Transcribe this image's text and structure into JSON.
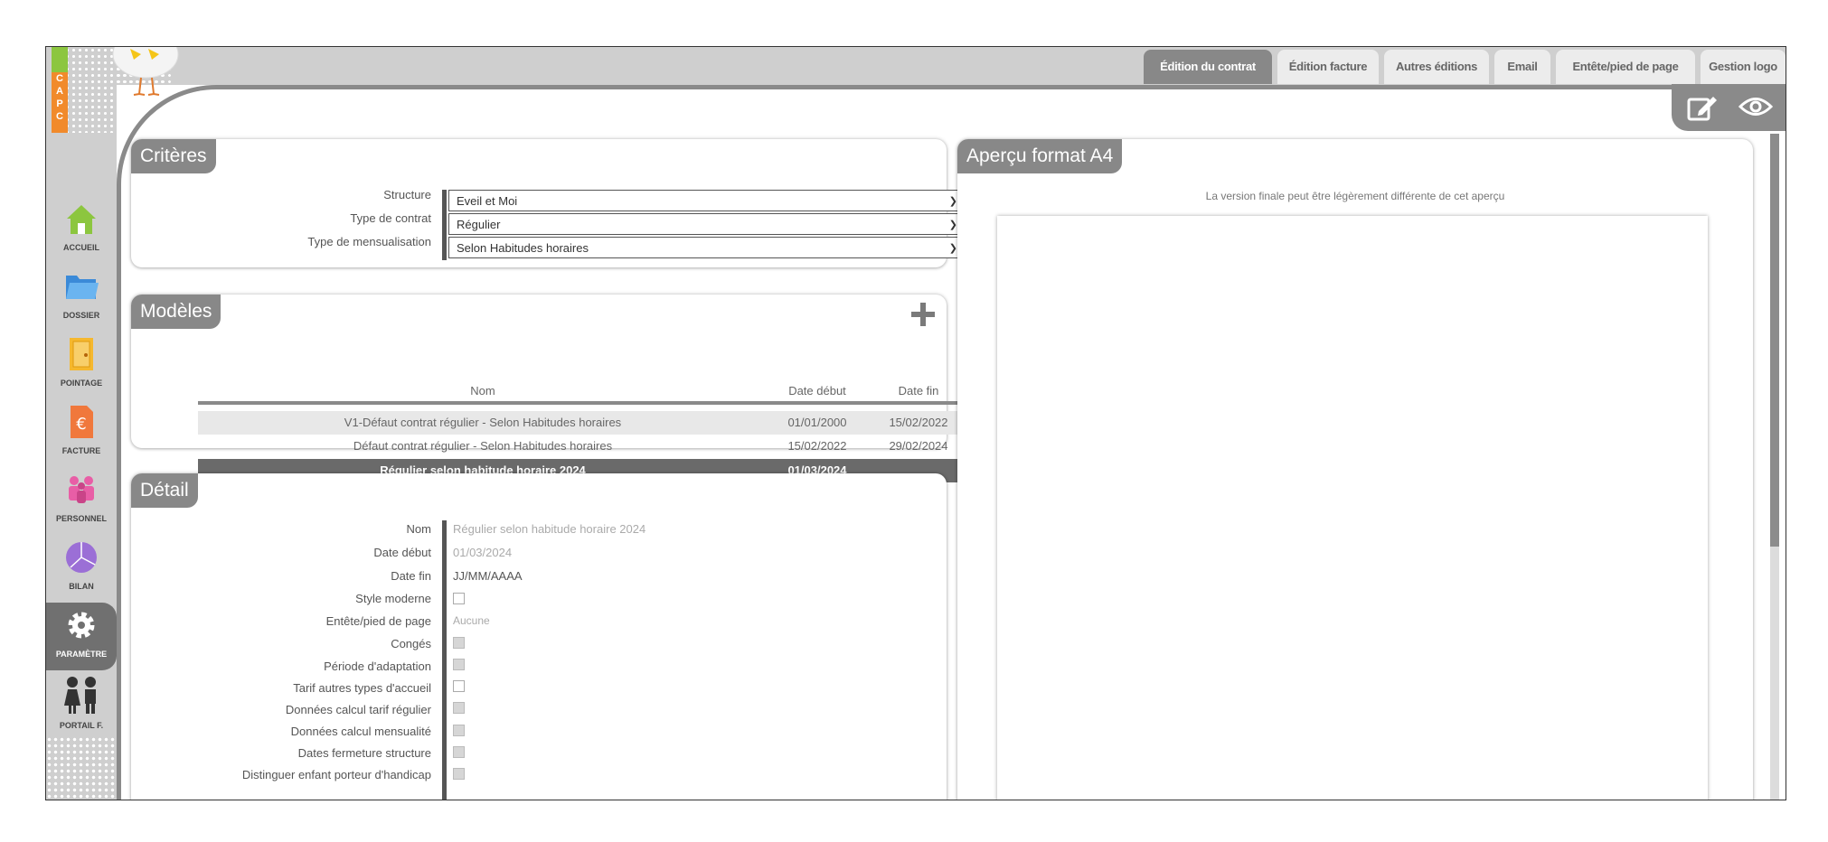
{
  "logo": {
    "letters": [
      "C",
      "A",
      "P",
      "C"
    ]
  },
  "tabs": [
    {
      "label": "Édition du contrat",
      "active": true
    },
    {
      "label": "Édition facture",
      "active": false
    },
    {
      "label": "Autres éditions",
      "active": false
    },
    {
      "label": "Email",
      "active": false
    },
    {
      "label": "Entête/pied de page",
      "active": false
    },
    {
      "label": "Gestion logo",
      "active": false
    }
  ],
  "sidebar": {
    "items": [
      {
        "label": "ACCUEIL",
        "icon": "house-icon",
        "color": "#8cc63f"
      },
      {
        "label": "DOSSIER",
        "icon": "folder-icon",
        "color": "#4a9fe0"
      },
      {
        "label": "POINTAGE",
        "icon": "door-icon",
        "color": "#f5b82e"
      },
      {
        "label": "FACTURE",
        "icon": "euro-document-icon",
        "color": "#f0783c"
      },
      {
        "label": "PERSONNEL",
        "icon": "people-icon",
        "color": "#e85ea6"
      },
      {
        "label": "BILAN",
        "icon": "pie-chart-icon",
        "color": "#9b6fd6"
      },
      {
        "label": "PARAMÈTRE",
        "icon": "gear-icon",
        "color": "#ffffff",
        "active": true
      },
      {
        "label": "PORTAIL F.",
        "icon": "children-icon",
        "color": "#444444"
      }
    ]
  },
  "criteres": {
    "title": "Critères",
    "fields": [
      {
        "label": "Structure",
        "value": "Eveil et Moi"
      },
      {
        "label": "Type de contrat",
        "value": "Régulier"
      },
      {
        "label": "Type de mensualisation",
        "value": "Selon Habitudes horaires"
      }
    ]
  },
  "modeles": {
    "title": "Modèles",
    "columns": [
      "Nom",
      "Date début",
      "Date fin"
    ],
    "rows": [
      {
        "nom": "V1-Défaut contrat régulier - Selon Habitudes horaires",
        "debut": "01/01/2000",
        "fin": "15/02/2022"
      },
      {
        "nom": "Défaut contrat régulier - Selon Habitudes horaires",
        "debut": "15/02/2022",
        "fin": "29/02/2024"
      },
      {
        "nom": "Régulier selon habitude horaire 2024",
        "debut": "01/03/2024",
        "fin": ""
      }
    ]
  },
  "detail": {
    "title": "Détail",
    "nom_label": "Nom",
    "nom_value": "Régulier selon habitude horaire 2024",
    "debut_label": "Date début",
    "debut_value": "01/03/2024",
    "fin_label": "Date fin",
    "fin_placeholder": "JJ/MM/AAAA",
    "style_label": "Style moderne",
    "entete_label": "Entête/pied de page",
    "entete_value": "Aucune",
    "conges_label": "Congés",
    "adaptation_label": "Période d'adaptation",
    "tarif_label": "Tarif autres types d'accueil",
    "donnees_tarif_label": "Données calcul tarif régulier",
    "donnees_mens_label": "Données calcul mensualité",
    "dates_fermeture_label": "Dates fermeture structure",
    "handicap_label": "Distinguer enfant porteur d'handicap"
  },
  "apercu": {
    "title": "Aperçu format A4",
    "notice": "La version finale peut être légèrement différente de cet aperçu"
  }
}
